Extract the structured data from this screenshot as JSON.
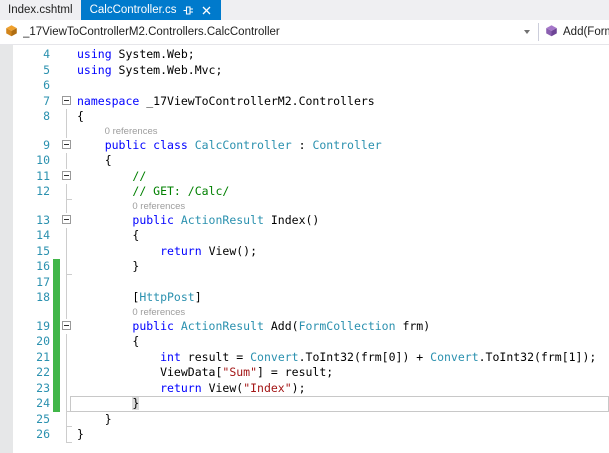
{
  "tab_bar": {
    "tabs": [
      {
        "label": "Index.cshtml",
        "active": false
      },
      {
        "label": "CalcController.cs",
        "active": true
      }
    ]
  },
  "navbar": {
    "type_selector": "_17ViewToControllerM2.Controllers.CalcController",
    "member_selector": "Add(Form"
  },
  "colors": {
    "active_tab": "#007ACC",
    "change_bar_green": "#41B649",
    "keyword": "#0000FF",
    "type_name": "#2B91AF",
    "comment": "#008000",
    "string": "#A31515",
    "plain": "#000000",
    "line_number": "#2B91AF"
  },
  "editor": {
    "codelens_label": "0 references",
    "lines": [
      {
        "type": "code",
        "num": "4",
        "guide": false,
        "segs": [
          {
            "t": "using ",
            "c": "kw"
          },
          {
            "t": "System.Web;",
            "c": "pl"
          }
        ]
      },
      {
        "type": "code",
        "num": "5",
        "guide": false,
        "segs": [
          {
            "t": "using ",
            "c": "kw"
          },
          {
            "t": "System.Web.Mvc;",
            "c": "pl"
          }
        ]
      },
      {
        "type": "code",
        "num": "6",
        "guide": false,
        "segs": []
      },
      {
        "type": "code",
        "num": "7",
        "fold": "box",
        "segs": [
          {
            "t": "namespace ",
            "c": "kw"
          },
          {
            "t": "_17ViewToControllerM2.Controllers",
            "c": "pl"
          }
        ]
      },
      {
        "type": "code",
        "num": "8",
        "guide": true,
        "segs": [
          {
            "t": "{",
            "c": "pl"
          }
        ]
      },
      {
        "type": "lens",
        "indent": 4,
        "guide": true
      },
      {
        "type": "code",
        "num": "9",
        "fold": "box",
        "segs": [
          {
            "t": "    ",
            "c": "pl"
          },
          {
            "t": "public class ",
            "c": "kw"
          },
          {
            "t": "CalcController",
            "c": "ty"
          },
          {
            "t": " : ",
            "c": "pl"
          },
          {
            "t": "Controller",
            "c": "ty"
          }
        ]
      },
      {
        "type": "code",
        "num": "10",
        "guide": true,
        "segs": [
          {
            "t": "    {",
            "c": "pl"
          }
        ]
      },
      {
        "type": "code",
        "num": "11",
        "fold": "box",
        "segs": [
          {
            "t": "        ",
            "c": "pl"
          },
          {
            "t": "//",
            "c": "cm"
          }
        ]
      },
      {
        "type": "code",
        "num": "12",
        "guide": true,
        "tick": true,
        "segs": [
          {
            "t": "        ",
            "c": "pl"
          },
          {
            "t": "// GET: /Calc/",
            "c": "cm"
          }
        ]
      },
      {
        "type": "lens",
        "indent": 8,
        "guide": true
      },
      {
        "type": "code",
        "num": "13",
        "fold": "box",
        "segs": [
          {
            "t": "        ",
            "c": "pl"
          },
          {
            "t": "public ",
            "c": "kw"
          },
          {
            "t": "ActionResult",
            "c": "ty"
          },
          {
            "t": " Index()",
            "c": "pl"
          }
        ]
      },
      {
        "type": "code",
        "num": "14",
        "guide": true,
        "segs": [
          {
            "t": "        {",
            "c": "pl"
          }
        ]
      },
      {
        "type": "code",
        "num": "15",
        "guide": true,
        "segs": [
          {
            "t": "            ",
            "c": "pl"
          },
          {
            "t": "return",
            "c": "kw"
          },
          {
            "t": " View();",
            "c": "pl"
          }
        ]
      },
      {
        "type": "code",
        "num": "16",
        "guide": true,
        "tick": true,
        "chg": true,
        "segs": [
          {
            "t": "        }",
            "c": "pl"
          }
        ]
      },
      {
        "type": "code",
        "num": "17",
        "guide": true,
        "chg": true,
        "segs": []
      },
      {
        "type": "code",
        "num": "18",
        "guide": true,
        "chg": true,
        "segs": [
          {
            "t": "        [",
            "c": "pl"
          },
          {
            "t": "HttpPost",
            "c": "ty"
          },
          {
            "t": "]",
            "c": "pl"
          }
        ]
      },
      {
        "type": "lens",
        "indent": 8,
        "guide": true,
        "chg": true
      },
      {
        "type": "code",
        "num": "19",
        "fold": "box",
        "chg": true,
        "segs": [
          {
            "t": "        ",
            "c": "pl"
          },
          {
            "t": "public ",
            "c": "kw"
          },
          {
            "t": "ActionResult",
            "c": "ty"
          },
          {
            "t": " Add(",
            "c": "pl"
          },
          {
            "t": "FormCollection",
            "c": "ty"
          },
          {
            "t": " frm)",
            "c": "pl"
          }
        ]
      },
      {
        "type": "code",
        "num": "20",
        "guide": true,
        "chg": true,
        "segs": [
          {
            "t": "        {",
            "c": "pl"
          }
        ]
      },
      {
        "type": "code",
        "num": "21",
        "guide": true,
        "chg": true,
        "segs": [
          {
            "t": "            ",
            "c": "pl"
          },
          {
            "t": "int",
            "c": "kw"
          },
          {
            "t": " result = ",
            "c": "pl"
          },
          {
            "t": "Convert",
            "c": "ty"
          },
          {
            "t": ".ToInt32(frm[0]) + ",
            "c": "pl"
          },
          {
            "t": "Convert",
            "c": "ty"
          },
          {
            "t": ".ToInt32(frm[1]);",
            "c": "pl"
          }
        ]
      },
      {
        "type": "code",
        "num": "22",
        "guide": true,
        "chg": true,
        "segs": [
          {
            "t": "            ViewData[",
            "c": "pl"
          },
          {
            "t": "\"Sum\"",
            "c": "st"
          },
          {
            "t": "] = result;",
            "c": "pl"
          }
        ]
      },
      {
        "type": "code",
        "num": "23",
        "guide": true,
        "chg": true,
        "segs": [
          {
            "t": "            ",
            "c": "pl"
          },
          {
            "t": "return",
            "c": "kw"
          },
          {
            "t": " View(",
            "c": "pl"
          },
          {
            "t": "\"Index\"",
            "c": "st"
          },
          {
            "t": ");",
            "c": "pl"
          }
        ]
      },
      {
        "type": "code",
        "num": "24",
        "guide": true,
        "tick": true,
        "chg": true,
        "current": true,
        "segs": [
          {
            "t": "        ",
            "c": "pl"
          },
          {
            "t": "}",
            "c": "pl hl"
          }
        ]
      },
      {
        "type": "code",
        "num": "25",
        "guide": true,
        "tick": true,
        "segs": [
          {
            "t": "    }",
            "c": "pl"
          }
        ]
      },
      {
        "type": "code",
        "num": "26",
        "guide": true,
        "tick": true,
        "segs": [
          {
            "t": "}",
            "c": "pl"
          }
        ]
      }
    ]
  }
}
